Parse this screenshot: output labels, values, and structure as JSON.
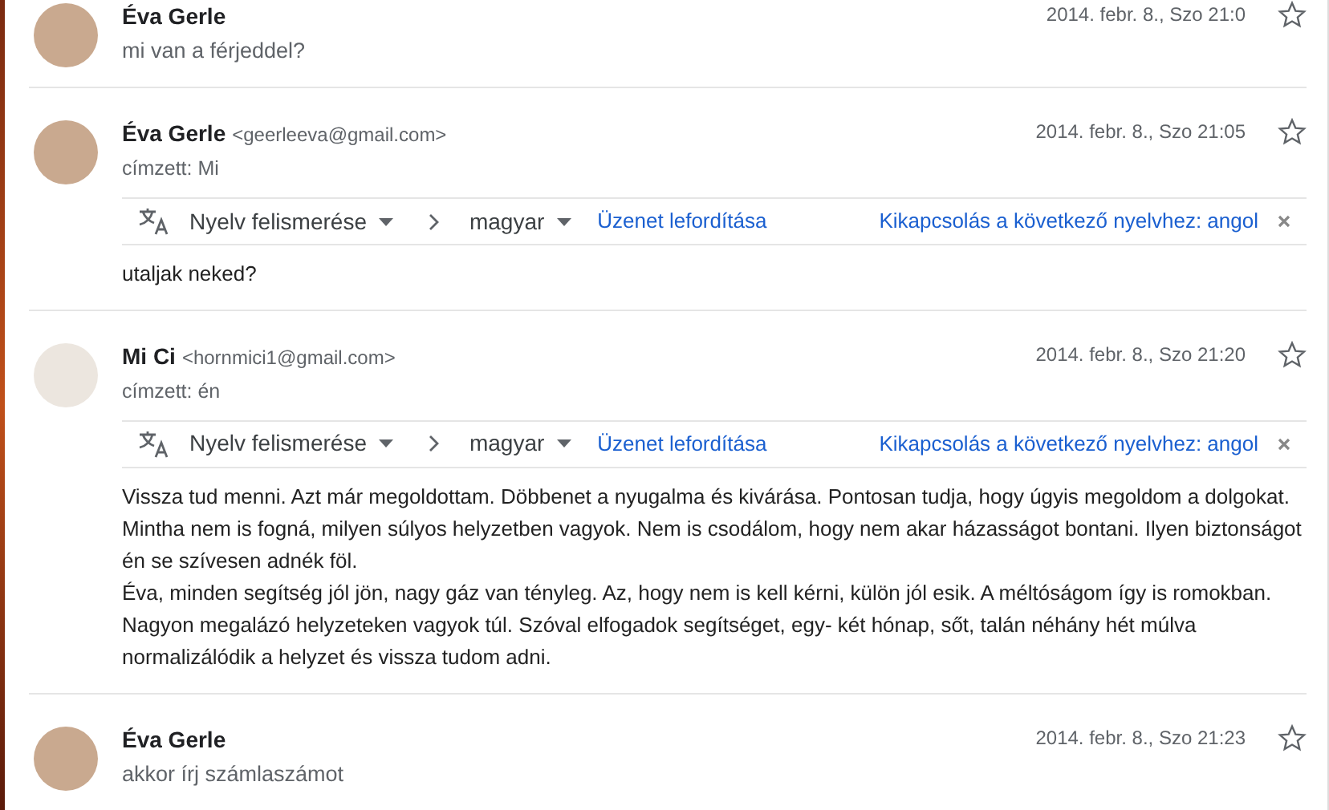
{
  "messages": [
    {
      "kind": "collapsed",
      "sender": "Éva Gerle",
      "date": "2014. febr. 8., Szo 21:0",
      "snippet": "mi van a férjeddel?",
      "starred": false
    },
    {
      "kind": "expanded",
      "sender": "Éva Gerle",
      "email": "<geerleeva@gmail.com>",
      "recipient": "címzett: Mi",
      "date": "2014. febr. 8., Szo 21:05",
      "starred": false,
      "translate": {
        "source": "Nyelv felismerése",
        "target": "magyar",
        "action": "Üzenet lefordítása",
        "disable": "Kikapcsolás a következő nyelvhez: angol"
      },
      "body": [
        "utaljak neked?"
      ]
    },
    {
      "kind": "expanded",
      "sender": "Mi Ci",
      "email": "<hornmici1@gmail.com>",
      "recipient": "címzett: én",
      "date": "2014. febr. 8., Szo 21:20",
      "starred": false,
      "translate": {
        "source": "Nyelv felismerése",
        "target": "magyar",
        "action": "Üzenet lefordítása",
        "disable": "Kikapcsolás a következő nyelvhez: angol"
      },
      "body": [
        "Vissza tud menni. Azt már megoldottam. Döbbenet a nyugalma és kivárása. Pontosan tudja, hogy úgyis megoldom a dolgokat. Mintha nem is fogná, milyen súlyos helyzetben vagyok. Nem is csodálom, hogy nem akar házasságot bontani. Ilyen biztonságot én se szívesen adnék föl.",
        "Éva, minden segítség jól jön, nagy gáz van tényleg. Az, hogy nem is kell kérni, külön jól esik. A méltóságom így is romokban. Nagyon megalázó helyzeteken vagyok túl. Szóval elfogadok segítséget, egy- két hónap, sőt, talán néhány hét múlva normalizálódik a helyzet és vissza tudom adni."
      ]
    },
    {
      "kind": "collapsed",
      "sender": "Éva Gerle",
      "date": "2014. febr. 8., Szo 21:23",
      "snippet": "akkor írj számlaszámot",
      "starred": false
    }
  ]
}
